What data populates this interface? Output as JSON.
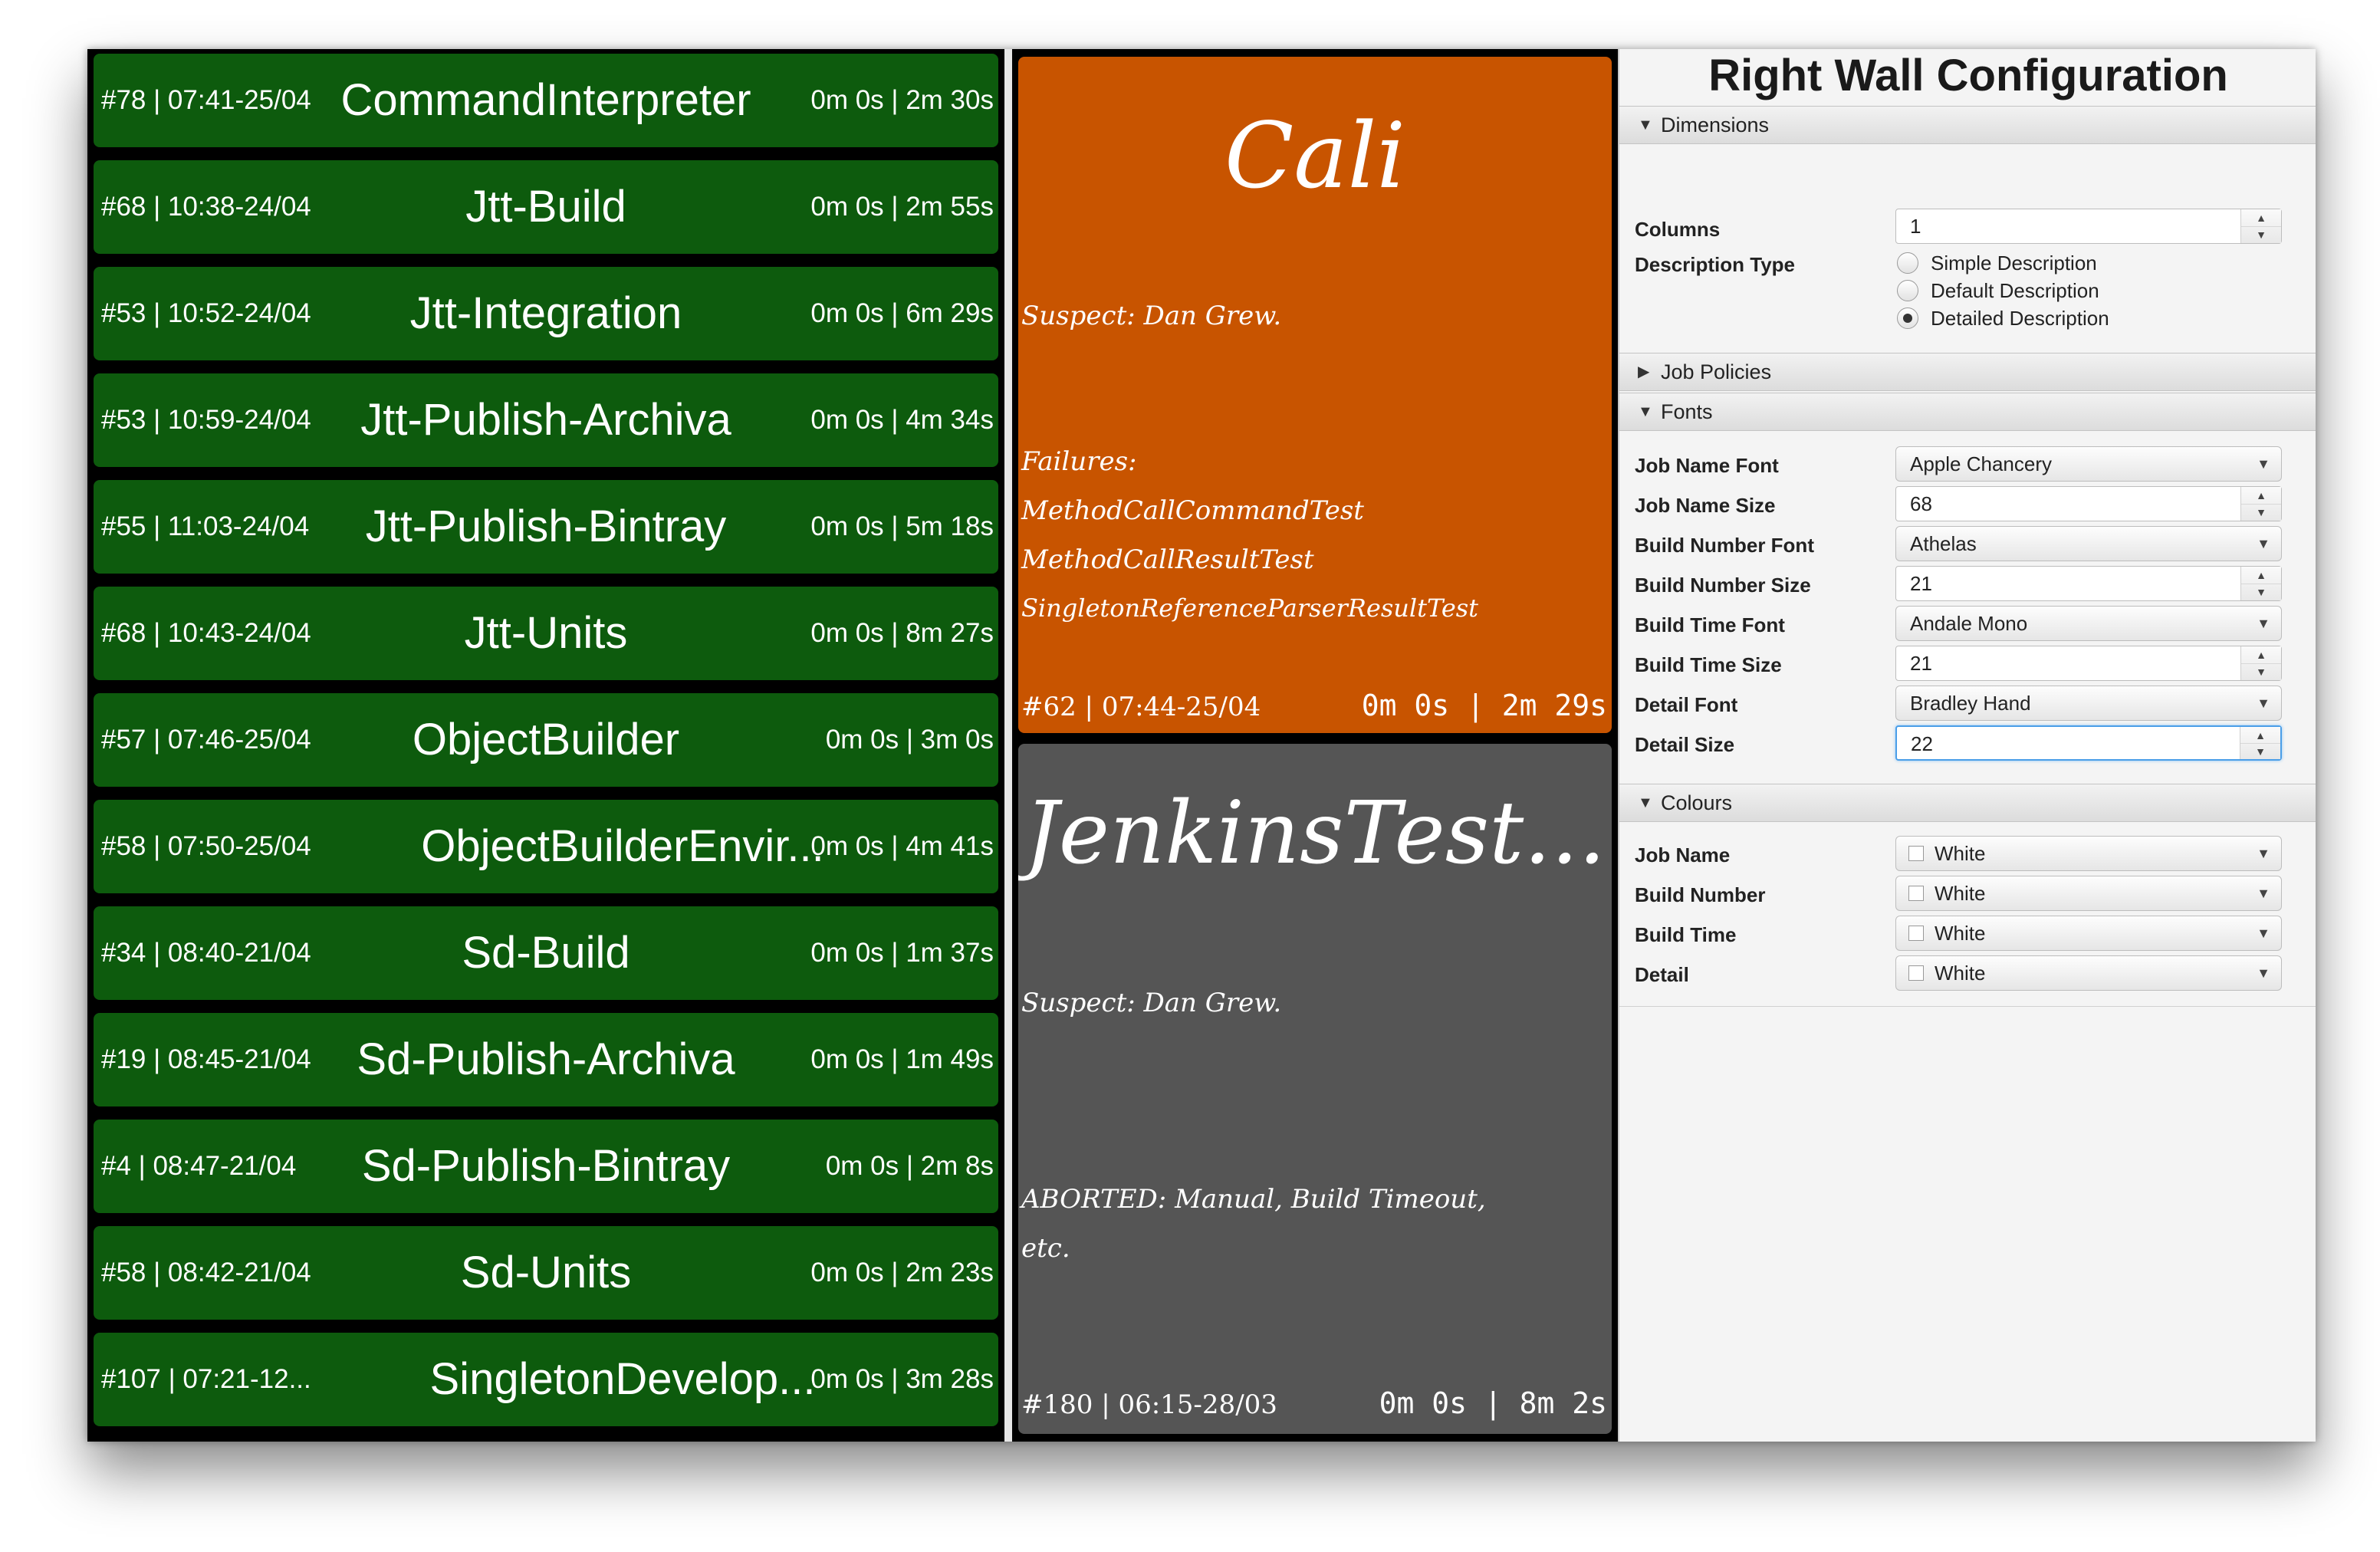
{
  "left_wall": {
    "jobs": [
      {
        "build": "#78 | 07:41-25/04",
        "name": "CommandInterpreter",
        "time": "0m 0s | 2m 30s"
      },
      {
        "build": "#68 | 10:38-24/04",
        "name": "Jtt-Build",
        "time": "0m 0s | 2m 55s"
      },
      {
        "build": "#53 | 10:52-24/04",
        "name": "Jtt-Integration",
        "time": "0m 0s | 6m 29s"
      },
      {
        "build": "#53 | 10:59-24/04",
        "name": "Jtt-Publish-Archiva",
        "time": "0m 0s | 4m 34s"
      },
      {
        "build": "#55 | 11:03-24/04",
        "name": "Jtt-Publish-Bintray",
        "time": "0m 0s | 5m 18s"
      },
      {
        "build": "#68 | 10:43-24/04",
        "name": "Jtt-Units",
        "time": "0m 0s | 8m 27s"
      },
      {
        "build": "#57 | 07:46-25/04",
        "name": "ObjectBuilder",
        "time": "0m 0s | 3m 0s"
      },
      {
        "build": "#58 | 07:50-25/04",
        "name": "ObjectBuilderEnvir...",
        "time": "0m 0s | 4m 41s"
      },
      {
        "build": "#34 | 08:40-21/04",
        "name": "Sd-Build",
        "time": "0m 0s | 1m 37s"
      },
      {
        "build": "#19 | 08:45-21/04",
        "name": "Sd-Publish-Archiva",
        "time": "0m 0s | 1m 49s"
      },
      {
        "build": "#4 | 08:47-21/04",
        "name": "Sd-Publish-Bintray",
        "time": "0m 0s | 2m 8s"
      },
      {
        "build": "#58 | 08:42-21/04",
        "name": "Sd-Units",
        "time": "0m 0s | 2m 23s"
      },
      {
        "build": "#107 | 07:21-12...",
        "name": "SingletonDevelop...",
        "time": "0m 0s | 3m 28s"
      }
    ],
    "colors": {
      "success": "#0d5b0d",
      "background": "#000000",
      "text": "#ffffff"
    }
  },
  "right_wall": {
    "tiles": [
      {
        "name": "Cali",
        "suspect": "Suspect: Dan Grew.",
        "failures_label": "Failures:",
        "failures": [
          "MethodCallCommandTest",
          "MethodCallResultTest",
          "SingletonReferenceParserResultTest"
        ],
        "build": "#62 | 07:44-25/04",
        "time": "0m 0s | 2m 29s",
        "color": "#c85400"
      },
      {
        "name": "JenkinsTest...",
        "suspect": "Suspect: Dan Grew.",
        "aborted_line1": "ABORTED: Manual, Build Timeout,",
        "aborted_line2": "etc.",
        "build": "#180 | 06:15-28/03",
        "time": "0m 0s | 8m 2s",
        "color": "#555555"
      }
    ]
  },
  "config": {
    "title": "Right Wall Configuration",
    "sections": {
      "dimensions": "Dimensions",
      "job_policies": "Job Policies",
      "fonts": "Fonts",
      "colours": "Colours"
    },
    "dimensions": {
      "columns_label": "Columns",
      "columns_value": "1",
      "description_type_label": "Description Type",
      "options": [
        "Simple Description",
        "Default Description",
        "Detailed Description"
      ],
      "selected_option": "Detailed Description"
    },
    "fonts": {
      "job_name_font_label": "Job Name Font",
      "job_name_font": "Apple Chancery",
      "job_name_size_label": "Job Name Size",
      "job_name_size": "68",
      "build_number_font_label": "Build Number Font",
      "build_number_font": "Athelas",
      "build_number_size_label": "Build Number Size",
      "build_number_size": "21",
      "build_time_font_label": "Build Time Font",
      "build_time_font": "Andale Mono",
      "build_time_size_label": "Build Time Size",
      "build_time_size": "21",
      "detail_font_label": "Detail Font",
      "detail_font": "Bradley Hand",
      "detail_size_label": "Detail Size",
      "detail_size": "22"
    },
    "colours": {
      "job_name_label": "Job Name",
      "job_name": "White",
      "build_number_label": "Build Number",
      "build_number": "White",
      "build_time_label": "Build Time",
      "build_time": "White",
      "detail_label": "Detail",
      "detail": "White"
    },
    "icons": {
      "expanded": "triangle-down-icon",
      "collapsed": "triangle-right-icon",
      "dropdown": "chevron-down-icon",
      "spinner": "up-down-arrows-icon"
    }
  }
}
